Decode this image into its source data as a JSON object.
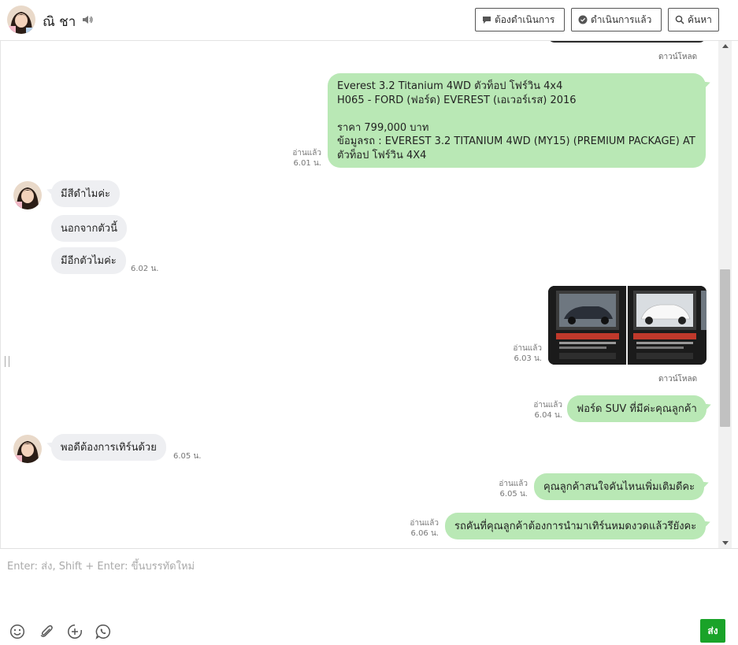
{
  "header": {
    "contact_name": "ณิ ชา",
    "buttons": {
      "todo": "ต้องดำเนินการ",
      "done": "ดำเนินการแล้ว",
      "search": "ค้นหา"
    }
  },
  "download_label": "ดาวน์โหลด",
  "messages": {
    "ford_detail": {
      "text": "Everest 3.2 Titanium 4WD ตัวท็อป โฟร์วิน 4x4\nH065 - FORD (ฟอร์ด) EVEREST (เอเวอร์เรส) 2016\n\nราคา 799,000 บาท\nข้อมูลรถ : EVEREST 3.2 TITANIUM 4WD (MY15) (PREMIUM PACKAGE) AT\nตัวท็อป โฟร์วิน 4X4",
      "read": "อ่านแล้ว",
      "time": "6.01 น."
    },
    "in1": {
      "text": "มีสีดำไมค่ะ"
    },
    "in2": {
      "text": "นอกจากตัวนี้"
    },
    "in3": {
      "text": "มีอีกตัวไมค่ะ",
      "time": "6.02 น."
    },
    "images": {
      "read": "อ่านแล้ว",
      "time": "6.03 น."
    },
    "out_suv": {
      "text": "ฟอร์ด SUV ที่มีค่ะคุณลูกค้า",
      "read": "อ่านแล้ว",
      "time": "6.04 น."
    },
    "in4": {
      "text": "พอดีต้องการเทิร์นด้วย",
      "time": "6.05 น."
    },
    "out_interest": {
      "text": "คุณลูกค้าสนใจคันไหนเพิ่มเติมดีคะ",
      "read": "อ่านแล้ว",
      "time": "6.05 น."
    },
    "out_tradein": {
      "text": "รถคันที่คุณลูกค้าต้องการนำมาเทิร์นหมดงวดแล้วรึยังคะ",
      "read": "อ่านแล้ว",
      "time": "6.06 น."
    }
  },
  "input": {
    "placeholder": "Enter: ส่ง, Shift + Enter: ขึ้นบรรทัดใหม่",
    "send_label": "ส่ง"
  },
  "colors": {
    "outgoing_bubble": "#b9e8b5",
    "incoming_bubble": "#eeeff2",
    "send_button": "#1aa329"
  }
}
